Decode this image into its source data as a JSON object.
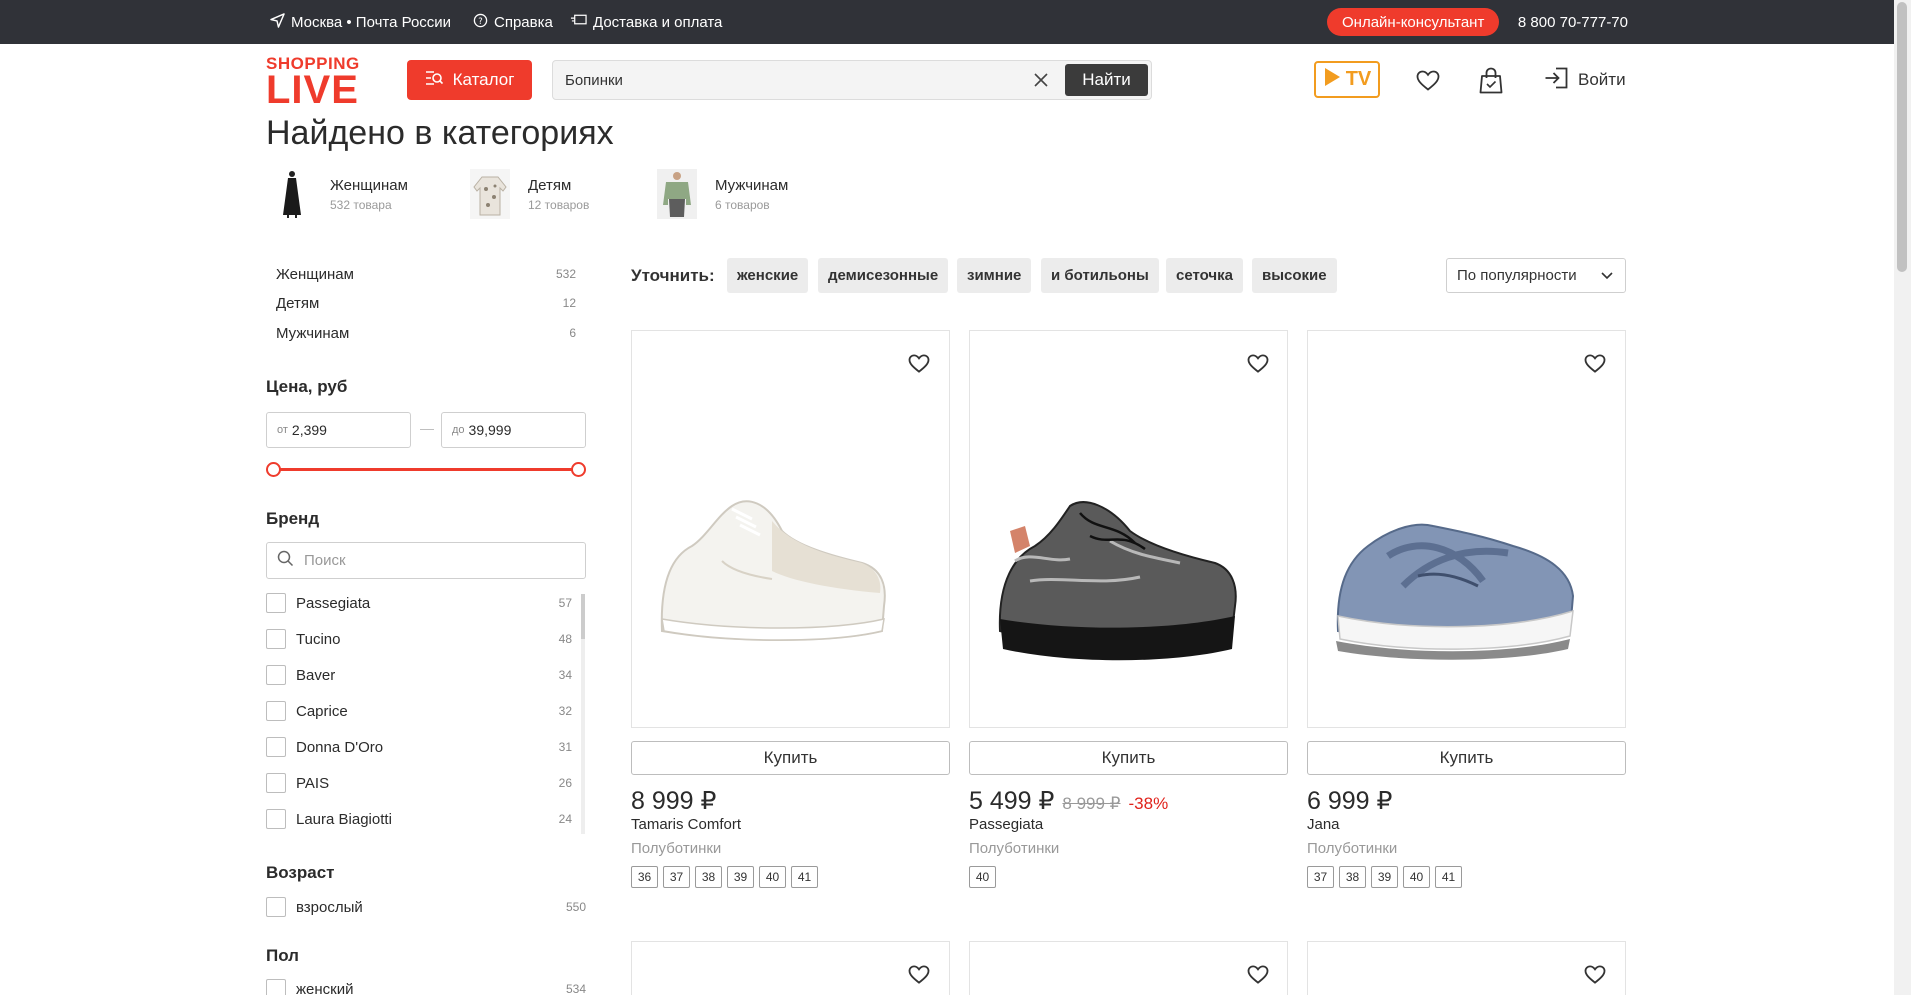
{
  "topbar": {
    "location": "Москва • Почта России",
    "help": "Справка",
    "delivery": "Доставка и оплата",
    "consultant": "Онлайн-консультант",
    "phone": "8 800 70-777-70"
  },
  "header": {
    "logo_top": "SHOPPING",
    "logo_bottom": "LIVE",
    "catalog_label": "Каталог",
    "search_value": "Бопинки",
    "find_label": "Найти",
    "tv_label": "TV",
    "login_label": "Войти"
  },
  "found": {
    "title": "Найдено в категориях",
    "categories": [
      {
        "name": "Женщинам",
        "count": "532 товара"
      },
      {
        "name": "Детям",
        "count": "12 товаров"
      },
      {
        "name": "Мужчинам",
        "count": "6 товаров"
      }
    ]
  },
  "sidebar": {
    "categories": [
      {
        "name": "Женщинам",
        "count": "532"
      },
      {
        "name": "Детям",
        "count": "12"
      },
      {
        "name": "Мужчинам",
        "count": "6"
      }
    ],
    "price": {
      "title": "Цена, руб",
      "from_prefix": "от",
      "from_value": "2,399",
      "dash": "—",
      "to_prefix": "до",
      "to_value": "39,999"
    },
    "brand": {
      "title": "Бренд",
      "search_placeholder": "Поиск",
      "items": [
        {
          "name": "Passegiata",
          "count": "57"
        },
        {
          "name": "Tucino",
          "count": "48"
        },
        {
          "name": "Baver",
          "count": "34"
        },
        {
          "name": "Caprice",
          "count": "32"
        },
        {
          "name": "Donna D'Oro",
          "count": "31"
        },
        {
          "name": "PAIS",
          "count": "26"
        },
        {
          "name": "Laura Biagiotti",
          "count": "24"
        }
      ]
    },
    "age": {
      "title": "Возраст",
      "items": [
        {
          "name": "взрослый",
          "count": "550"
        }
      ]
    },
    "gender": {
      "title": "Пол",
      "items": [
        {
          "name": "женский",
          "count": "534"
        }
      ]
    }
  },
  "refine": {
    "label": "Уточнить:",
    "chips": [
      "женские",
      "демисезонные",
      "зимние",
      "и ботильоны",
      "сеточка",
      "высокие"
    ],
    "sort": "По популярности"
  },
  "products": [
    {
      "buy": "Купить",
      "price": "8 999 ₽",
      "old_price": "",
      "discount": "",
      "brand": "Tamaris Comfort",
      "type": "Полуботинки",
      "sizes": [
        "36",
        "37",
        "38",
        "39",
        "40",
        "41"
      ]
    },
    {
      "buy": "Купить",
      "price": "5 499 ₽",
      "old_price": "8 999 ₽",
      "discount": "-38%",
      "brand": "Passegiata",
      "type": "Полуботинки",
      "sizes": [
        "40"
      ]
    },
    {
      "buy": "Купить",
      "price": "6 999 ₽",
      "old_price": "",
      "discount": "",
      "brand": "Jana",
      "type": "Полуботинки",
      "sizes": [
        "37",
        "38",
        "39",
        "40",
        "41"
      ]
    }
  ],
  "colors": {
    "accent": "#ef3b2c",
    "topbar": "#303238",
    "tv": "#f29c1f",
    "discount": "#e0221b"
  }
}
